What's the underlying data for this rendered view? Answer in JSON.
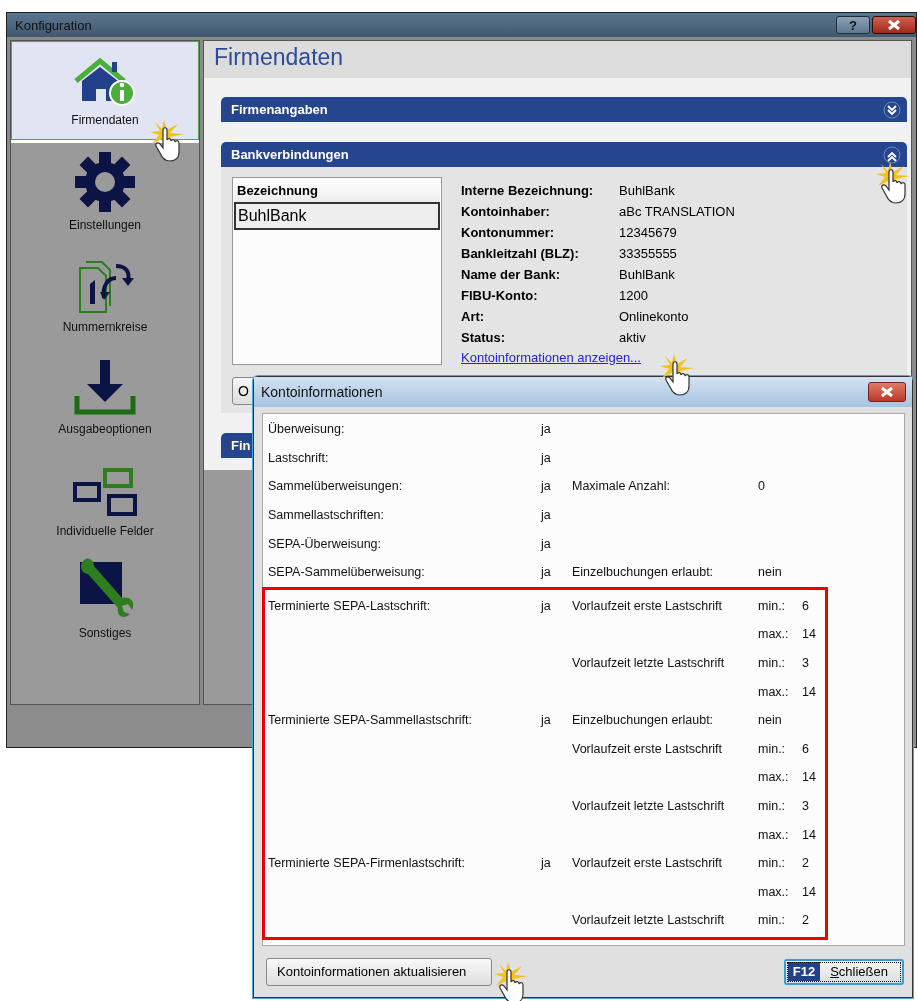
{
  "window": {
    "title": "Konfiguration",
    "help_button": "?"
  },
  "sidebar": {
    "items": [
      {
        "label": "Firmendaten",
        "selected": true
      },
      {
        "label": "Einstellungen",
        "selected": false
      },
      {
        "label": "Nummernkreise",
        "selected": false
      },
      {
        "label": "Ausgabeoptionen",
        "selected": false
      },
      {
        "label": "Individuelle Felder",
        "selected": false
      },
      {
        "label": "Sonstiges",
        "selected": false
      }
    ]
  },
  "page_title": "Firmendaten",
  "sections": [
    {
      "title": "Firmenangaben",
      "expanded": false
    },
    {
      "title": "Bankverbindungen",
      "expanded": true
    },
    {
      "title": "Fin"
    }
  ],
  "bank": {
    "list": {
      "header": "Bezeichnung",
      "rows": [
        {
          "label": "BuhlBank",
          "selected": true
        }
      ]
    },
    "details": [
      {
        "label": "Interne Bezeichnung:",
        "value": "BuhlBank"
      },
      {
        "label": "Kontoinhaber:",
        "value": "aBc TRANSLATION"
      },
      {
        "label": "Kontonummer:",
        "value": "12345679"
      },
      {
        "label": "Bankleitzahl (BLZ):",
        "value": "33355555"
      },
      {
        "label": "Name der Bank:",
        "value": "BuhlBank"
      },
      {
        "label": "FIBU-Konto:",
        "value": "1200"
      },
      {
        "label": "Art:",
        "value": "Onlinekonto"
      },
      {
        "label": "Status:",
        "value": "aktiv"
      }
    ],
    "link": "Kontoinformationen anzeigen...",
    "button": "O"
  },
  "dialog": {
    "title": "Kontoinformationen",
    "rows": [
      {
        "cells": [
          "Überweisung:",
          "ja",
          "",
          "",
          ""
        ],
        "highlighted": false
      },
      {
        "cells": [
          "Lastschrift:",
          "ja",
          "",
          "",
          ""
        ],
        "highlighted": false
      },
      {
        "cells": [
          "Sammelüberweisungen:",
          "ja",
          "Maximale Anzahl:",
          "0",
          ""
        ],
        "highlighted": false
      },
      {
        "cells": [
          "Sammellastschriften:",
          "ja",
          "",
          "",
          ""
        ],
        "highlighted": false
      },
      {
        "cells": [
          "SEPA-Überweisung:",
          "ja",
          "",
          "",
          ""
        ],
        "highlighted": false
      },
      {
        "cells": [
          "SEPA-Sammelüberweisung:",
          "ja",
          "Einzelbuchungen erlaubt:",
          "nein",
          ""
        ],
        "highlighted": false
      },
      {
        "cells": [
          "Terminierte SEPA-Lastschrift:",
          "ja",
          "Vorlaufzeit erste Lastschrift",
          "min.:",
          "6"
        ],
        "highlighted": true
      },
      {
        "cells": [
          "",
          "",
          "",
          "max.:",
          "14"
        ],
        "highlighted": true
      },
      {
        "cells": [
          "",
          "",
          "Vorlaufzeit letzte Lastschrift",
          "min.:",
          "3"
        ],
        "highlighted": true
      },
      {
        "cells": [
          "",
          "",
          "",
          "max.:",
          "14"
        ],
        "highlighted": true
      },
      {
        "cells": [
          "Terminierte SEPA-Sammellastschrift:",
          "ja",
          "Einzelbuchungen erlaubt:",
          "nein",
          ""
        ],
        "highlighted": true
      },
      {
        "cells": [
          "",
          "",
          "Vorlaufzeit erste Lastschrift",
          "min.:",
          "6"
        ],
        "highlighted": true
      },
      {
        "cells": [
          "",
          "",
          "",
          "max.:",
          "14"
        ],
        "highlighted": true
      },
      {
        "cells": [
          "",
          "",
          "Vorlaufzeit letzte Lastschrift",
          "min.:",
          "3"
        ],
        "highlighted": true
      },
      {
        "cells": [
          "",
          "",
          "",
          "max.:",
          "14"
        ],
        "highlighted": true
      },
      {
        "cells": [
          "Terminierte SEPA-Firmenlastschrift:",
          "ja",
          "Vorlaufzeit erste Lastschrift",
          "min.:",
          "2"
        ],
        "highlighted": true
      },
      {
        "cells": [
          "",
          "",
          "",
          "max.:",
          "14"
        ],
        "highlighted": true
      },
      {
        "cells": [
          "",
          "",
          "Vorlaufzeit letzte Lastschrift",
          "min.:",
          "2"
        ],
        "highlighted": true
      }
    ],
    "update_button": "Kontoinformationen aktualisieren",
    "close_button": {
      "shortcut": "F12",
      "label": "Schließen"
    }
  }
}
